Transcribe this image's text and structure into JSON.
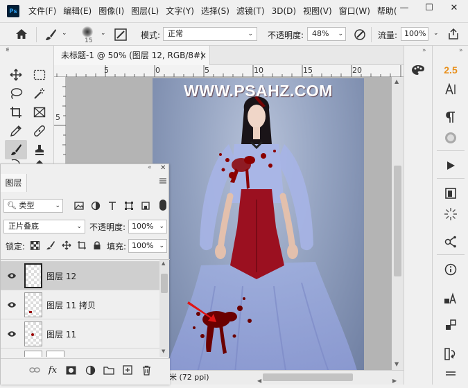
{
  "app": {
    "logo": "Ps"
  },
  "menu": [
    "文件(F)",
    "编辑(E)",
    "图像(I)",
    "图层(L)",
    "文字(Y)",
    "选择(S)",
    "滤镜(T)",
    "3D(D)",
    "视图(V)",
    "窗口(W)",
    "帮助("
  ],
  "window_controls": {
    "minimize": "—",
    "restore": "☐",
    "close": "✕"
  },
  "options": {
    "brush_size": "15",
    "mode_label": "模式:",
    "mode_value": "正常",
    "opacity_label": "不透明度:",
    "opacity_value": "48%",
    "flow_label": "流量:",
    "flow_value": "100%"
  },
  "document": {
    "tab_title": "未标题-1 @ 50% (图层 12, RGB/8#) *",
    "tab_close": "×",
    "status": "米 (72 ppi)"
  },
  "rulers": {
    "top": [
      "5",
      "0",
      "5",
      "10",
      "15",
      "20"
    ],
    "left": [
      "5"
    ]
  },
  "watermark": "WWW.PSAHZ.COM",
  "right_panel": {
    "badge": "2.5"
  },
  "layers_panel": {
    "tab": "图层",
    "filter_label": "类型",
    "blend_mode": "正片叠底",
    "opacity_label": "不透明度:",
    "opacity_value": "100%",
    "lock_label": "锁定:",
    "fill_label": "填充:",
    "fill_value": "100%",
    "layers": [
      {
        "name": "图层 12",
        "selected": true
      },
      {
        "name": "图层 11 拷贝",
        "selected": false
      },
      {
        "name": "图层 11",
        "selected": false
      }
    ],
    "footer_fx": "fx"
  },
  "colors": {
    "accent_orange": "#e8901c",
    "blood": "#8b0000",
    "selected_row": "#cfcfcf"
  }
}
